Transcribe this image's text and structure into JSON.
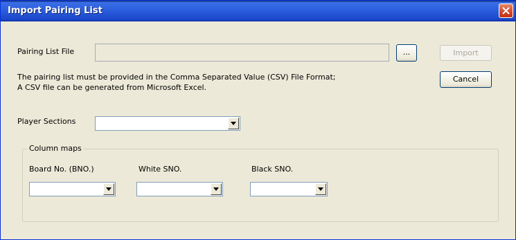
{
  "window": {
    "title": "Import Pairing List"
  },
  "file": {
    "label": "Pairing List File",
    "value": "",
    "browse_label": "..."
  },
  "buttons": {
    "import": "Import",
    "cancel": "Cancel"
  },
  "info": {
    "line1": "The pairing list must be provided in the Comma Separated Value (CSV) File Format;",
    "line2": "A CSV file can be generated from Microsoft Excel."
  },
  "sections": {
    "label": "Player Sections",
    "value": ""
  },
  "column_maps": {
    "legend": "Column maps",
    "board_label": "Board No. (BNO.)",
    "white_label": "White SNO.",
    "black_label": "Black SNO.",
    "board_value": "",
    "white_value": "",
    "black_value": ""
  },
  "colors": {
    "title_bar": "#2a5bdc",
    "dialog_bg": "#ece9d8",
    "close": "#d6462a"
  },
  "icons": {
    "close": "close-icon",
    "dropdown": "chevron-down-icon"
  }
}
